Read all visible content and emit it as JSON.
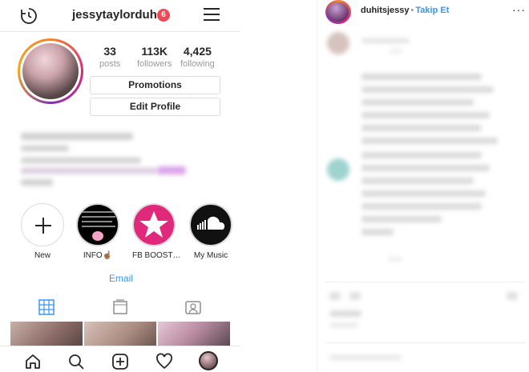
{
  "profile": {
    "username": "jessytaylorduh",
    "notification_count": "6",
    "stats": [
      {
        "value": "33",
        "label": "posts"
      },
      {
        "value": "113K",
        "label": "followers"
      },
      {
        "value": "4,425",
        "label": "following"
      }
    ],
    "promotions_label": "Promotions",
    "edit_profile_label": "Edit Profile",
    "highlights": [
      {
        "label": "New"
      },
      {
        "label": "INFO☝🏽"
      },
      {
        "label": "FB BOOST…"
      },
      {
        "label": "My Music"
      }
    ],
    "email_label": "Email"
  },
  "post": {
    "username": "duhitsjessy",
    "separator": "•",
    "follow_label": "Takip Et",
    "more": "···"
  },
  "colors": {
    "accent": "#3897f0",
    "badge": "#ed4956",
    "highlight_pink": "#e0297b"
  },
  "icons": {
    "top_left": "history-icon",
    "top_right": "menu-icon",
    "tabs": [
      "grid-icon",
      "igtv-icon",
      "tagged-icon"
    ],
    "bottom_nav": [
      "home-icon",
      "search-icon",
      "add-post-icon",
      "heart-icon",
      "profile-avatar"
    ]
  }
}
